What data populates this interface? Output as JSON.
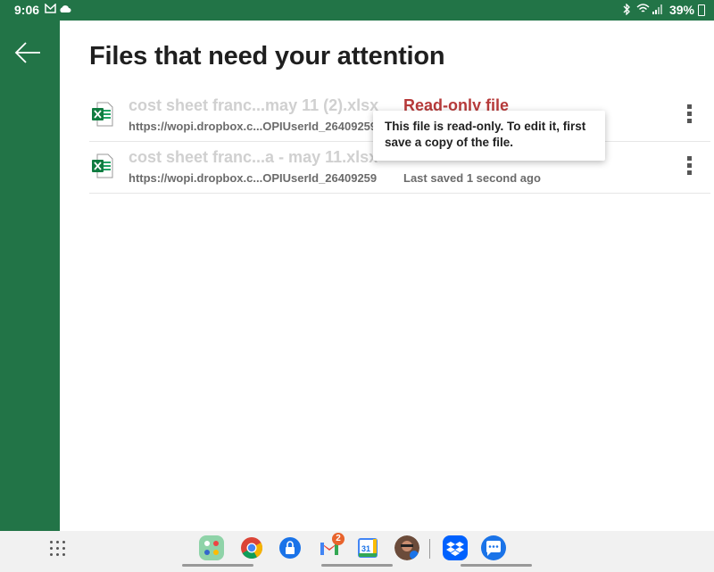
{
  "status_bar": {
    "time": "9:06",
    "battery": "39%"
  },
  "page": {
    "title": "Files that need your attention"
  },
  "files": [
    {
      "name": "cost sheet franc...may 11 (2).xlsx",
      "url": "https://wopi.dropbox.c...OPIUserId_26409259",
      "status": "Read-only file",
      "status_color": "#b73a3a"
    },
    {
      "name": "cost sheet franc...a - may 11.xlsx",
      "url": "https://wopi.dropbox.c...OPIUserId_26409259",
      "status": "Last saved 1 second ago"
    }
  ],
  "tooltip": {
    "text": "This file is read-only. To edit it, first save a copy of the file."
  },
  "dock": {
    "gmail_badge": "2",
    "calendar_day": "31"
  },
  "colors": {
    "excel_green": "#227447",
    "read_only_red": "#b73a3a"
  },
  "icons": [
    "back-arrow-icon",
    "excel-file-icon",
    "more-vertical-icon",
    "app-grid-icon",
    "chrome-icon",
    "gmail-icon",
    "calendar-icon",
    "dropbox-icon",
    "messages-icon"
  ]
}
